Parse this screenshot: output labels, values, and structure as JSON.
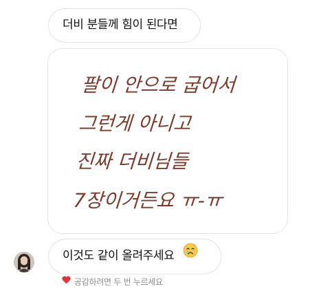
{
  "messages": {
    "top_text": "더비 분들께 힘이 된다면",
    "image_note": {
      "lines": [
        "팔이 안으로 굽어서",
        "그런게 아니고",
        "진짜 더비님들",
        "7장이거든요 ㅠ-ㅠ"
      ],
      "ink_color": "#7a3c2f"
    },
    "bottom_text": "이것도 같이 올려주세요",
    "bottom_emoji": "crying-face-emoji"
  },
  "reaction_hint": {
    "text": "공감하려면 두 번 누르세요",
    "icon": "heart-icon",
    "heart_color": "#e0353a"
  },
  "colors": {
    "bubble_border": "#e3e3e3",
    "hint_text": "#8e8e8e"
  }
}
